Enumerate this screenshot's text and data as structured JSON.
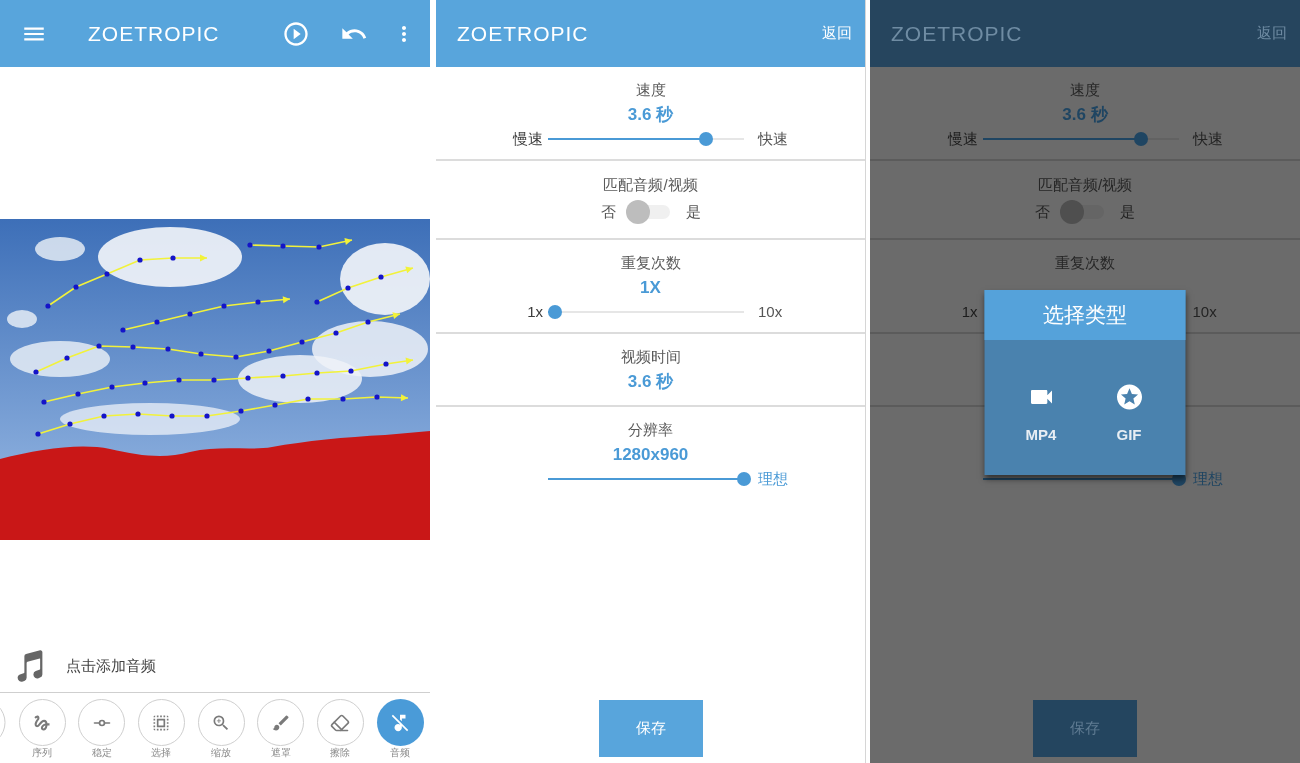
{
  "editor": {
    "app_bar": {
      "title": "ZOETROPIC"
    },
    "audio_prompt": "点击添加音频",
    "toolbar": {
      "scrolled_left": true,
      "tools": [
        {
          "kind": "sequence",
          "label": "序列",
          "selected": false
        },
        {
          "kind": "stabilize",
          "label": "稳定",
          "selected": false
        },
        {
          "kind": "select",
          "label": "选择",
          "selected": false
        },
        {
          "kind": "zoom",
          "label": "缩放",
          "selected": false
        },
        {
          "kind": "mask",
          "label": "遮罩",
          "selected": false
        },
        {
          "kind": "erase",
          "label": "擦除",
          "selected": false
        },
        {
          "kind": "audio",
          "label": "音频",
          "selected": true
        }
      ]
    }
  },
  "export_settings": {
    "app_bar": {
      "title": "ZOETROPIC",
      "back": "返回"
    },
    "sections": [
      {
        "kind": "slider",
        "title": "速度",
        "value": "3.6 秒",
        "min_label": "慢速",
        "max_label": "快速",
        "level": 0.8
      },
      {
        "kind": "switch",
        "title": "匹配音频/视频",
        "off_label": "否",
        "on_label": "是",
        "on": false
      },
      {
        "kind": "slider",
        "title": "重复次数",
        "value": "1X",
        "min_label": "1x",
        "max_label": "10x",
        "level": 0
      },
      {
        "kind": "readout",
        "title": "视频时间",
        "value": "3.6 秒"
      },
      {
        "kind": "slider",
        "title": "分辨率",
        "value": "1280x960",
        "max_label": "理想",
        "level": 1
      }
    ],
    "save_button": "保存"
  },
  "export_settings_dialog": {
    "app_bar": {
      "title": "ZOETROPIC",
      "back": "返回"
    },
    "sections": [
      {
        "kind": "slider",
        "title": "速度",
        "value": "3.6 秒",
        "min_label": "慢速",
        "max_label": "快速",
        "level": 0.8
      },
      {
        "kind": "switch",
        "title": "匹配音频/视频",
        "off_label": "否",
        "on_label": "是",
        "on": false
      },
      {
        "kind": "slider",
        "title": "重复次数",
        "min_label": "1x",
        "max_label": "10x"
      },
      {
        "kind": "readout"
      },
      {
        "kind": "slider",
        "max_label": "理想",
        "level": 1
      }
    ],
    "save_button": "保存",
    "dialog": {
      "title": "选择类型",
      "options": [
        {
          "kind": "video",
          "label": "MP4"
        },
        {
          "kind": "gif",
          "label": "GIF"
        }
      ]
    }
  }
}
